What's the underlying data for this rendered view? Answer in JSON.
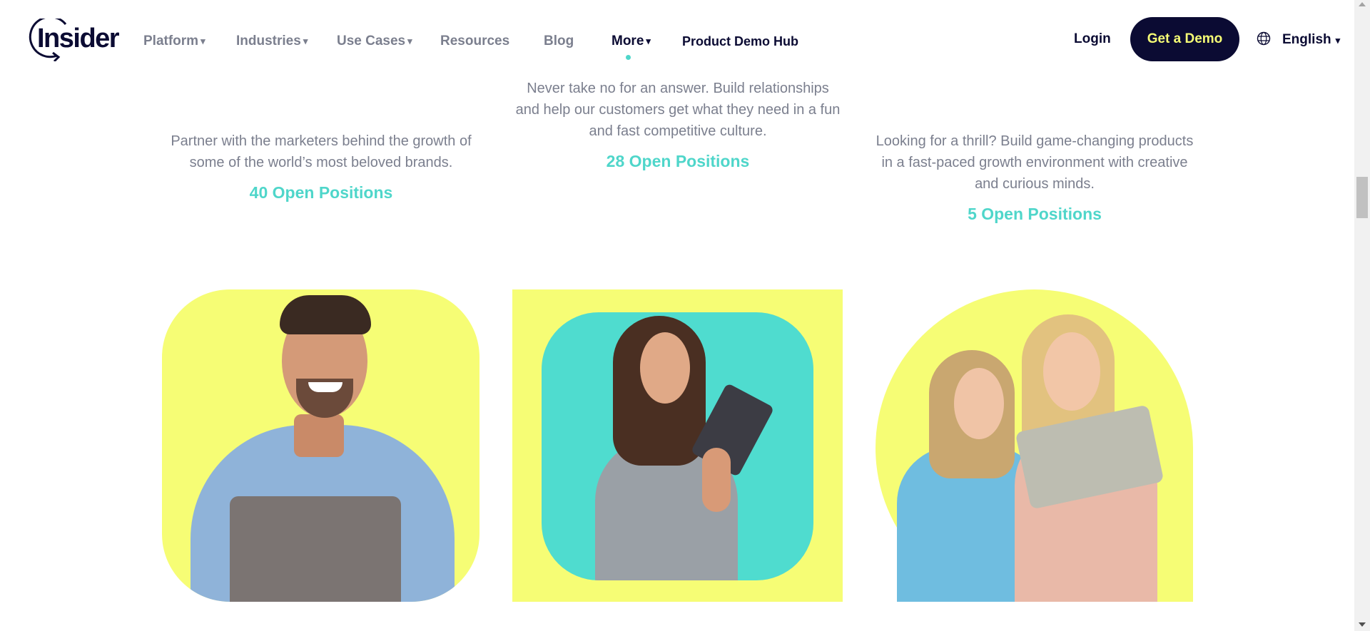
{
  "header": {
    "logo_text": "Insider",
    "nav": [
      {
        "label": "Platform",
        "caret": "▾"
      },
      {
        "label": "Industries",
        "caret": "▾"
      },
      {
        "label": "Use Cases",
        "caret": "▾"
      },
      {
        "label": "Resources"
      },
      {
        "label": "Blog"
      },
      {
        "label": "More",
        "caret": "▾"
      },
      {
        "label": "Product Demo Hub"
      }
    ],
    "login_label": "Login",
    "demo_label": "Get a Demo",
    "language_label": "English",
    "language_caret": "▾"
  },
  "columns": [
    {
      "description": "Partner with the marketers behind the growth of some of the world’s most beloved brands.",
      "link": "40 Open Positions"
    },
    {
      "description": "Never take no for an answer. Build relationships and help our customers get what they need in a fun and fast competitive culture.",
      "link": "28 Open Positions"
    },
    {
      "description": "Looking for a thrill? Build game-changing products in a fast-paced growth environment with creative and curious minds.",
      "link": "5 Open Positions"
    }
  ],
  "colors": {
    "navy": "#0b0b33",
    "teal": "#4fd6ca",
    "yellow": "#f6fd75",
    "gray_text": "#7b7f8e"
  },
  "icons": [
    "globe-icon",
    "caret-down-icon",
    "insider-logo"
  ]
}
